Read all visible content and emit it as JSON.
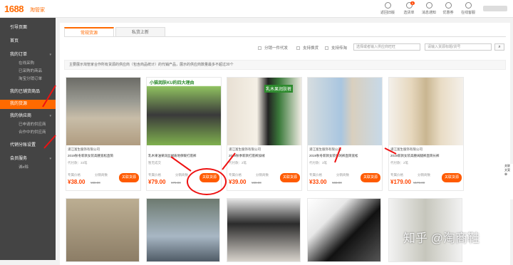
{
  "header": {
    "logo": "1688",
    "logo_sub": "淘管家",
    "actions": [
      {
        "label": "返回旧版",
        "icon": "back-icon"
      },
      {
        "label": "选货单",
        "icon": "cart-icon",
        "badge": "5"
      },
      {
        "label": "消息通知",
        "icon": "message-icon"
      },
      {
        "label": "优惠券",
        "icon": "coupon-icon"
      },
      {
        "label": "在线客服",
        "icon": "service-icon"
      }
    ]
  },
  "sidebar": {
    "items": [
      {
        "label": "引导页面",
        "type": "group"
      },
      {
        "label": "首页",
        "type": "group"
      },
      {
        "label": "我的订单",
        "type": "group",
        "arrow": "▾"
      },
      {
        "label": "在线采购",
        "type": "sub"
      },
      {
        "label": "已采购的商品",
        "type": "sub"
      },
      {
        "label": "淘宝分销订单",
        "type": "sub"
      },
      {
        "label": "我的已铺货商品",
        "type": "group"
      },
      {
        "label": "我的货源",
        "type": "active"
      },
      {
        "label": "我的供应商",
        "type": "group",
        "arrow": "▾"
      },
      {
        "label": "已申请的供应商",
        "type": "sub"
      },
      {
        "label": "合作中的供应商",
        "type": "sub"
      },
      {
        "label": "代销分账设置",
        "type": "group"
      },
      {
        "label": "会员服务",
        "type": "group",
        "arrow": "▾"
      },
      {
        "label": "诚e赊",
        "type": "sub"
      }
    ]
  },
  "tabs": [
    {
      "label": "常规货源"
    },
    {
      "label": "私货上新"
    }
  ],
  "filters": {
    "opt1": "分销一件代发",
    "opt2": "支持换货",
    "opt3": "支持传淘",
    "select_placeholder": "选择或者输入供应商旺旺",
    "input_placeholder": "请输入货源标题/货号",
    "search_label": "⌕"
  },
  "notice": "主要展示淘管家合作所有货源的供应商（包含商品统计）的代销产品，展示的供应商数量最多不超过30个",
  "cards": [
    {
      "shop": "浦江富生服饰有限公司",
      "title": "2019秋冬新款女装高腰宽松直筒",
      "meta": "代付款：33笔",
      "label": "专属价格",
      "price": "¥38.00",
      "old": "¥38.00",
      "dist": "分销商数",
      "btn": "关联货源",
      "colors": [
        "#c2b49c",
        "#e8e2d6"
      ]
    },
    {
      "shop": "",
      "title": "乳木果油果润丝绒质地保暖打底裤",
      "meta": "暂无成交",
      "label": "专属价格",
      "price": "¥79.00",
      "old": "¥79.00",
      "dist": "分销商数",
      "btn": "关联货源",
      "colors": [
        "#9bc36a",
        "#2a2a2a"
      ],
      "overlay_title": "小猫润肤KU的四大理由"
    },
    {
      "shop": "浦江富生服饰有限公司",
      "title": "2019秋季新款打底裤加绒",
      "meta": "代付款：2笔",
      "label": "专属价格",
      "price": "¥39.00",
      "old": "¥39.00",
      "dist": "分销商数",
      "btn": "关联货源",
      "colors": [
        "#6cc36c",
        "#222"
      ],
      "overlay_title": "乳木果润肤裤"
    },
    {
      "shop": "浦江富生服饰有限公司",
      "title": "2019秋冬新款女装休闲裤直筒宽松",
      "meta": "代付款：3笔",
      "label": "专属价格",
      "price": "¥33.00",
      "old": "¥33.00",
      "dist": "分销商数",
      "btn": "关联货源",
      "colors": [
        "#d8d0c2",
        "#8fb3d9"
      ]
    },
    {
      "shop": "浦江富生服饰有限公司",
      "title": "2019新款女装高腰阔腿裤直筒长裤",
      "meta": "代付款：2笔",
      "label": "专属价格",
      "price": "¥179.00",
      "old": "¥179.00",
      "dist": "分销商数",
      "btn": "关联货源",
      "colors": [
        "#e8d8c0",
        "#f0ece4"
      ]
    }
  ],
  "watermark": "知乎 @淘商鞋",
  "right_edge": [
    "关联",
    "文案",
    "单"
  ]
}
